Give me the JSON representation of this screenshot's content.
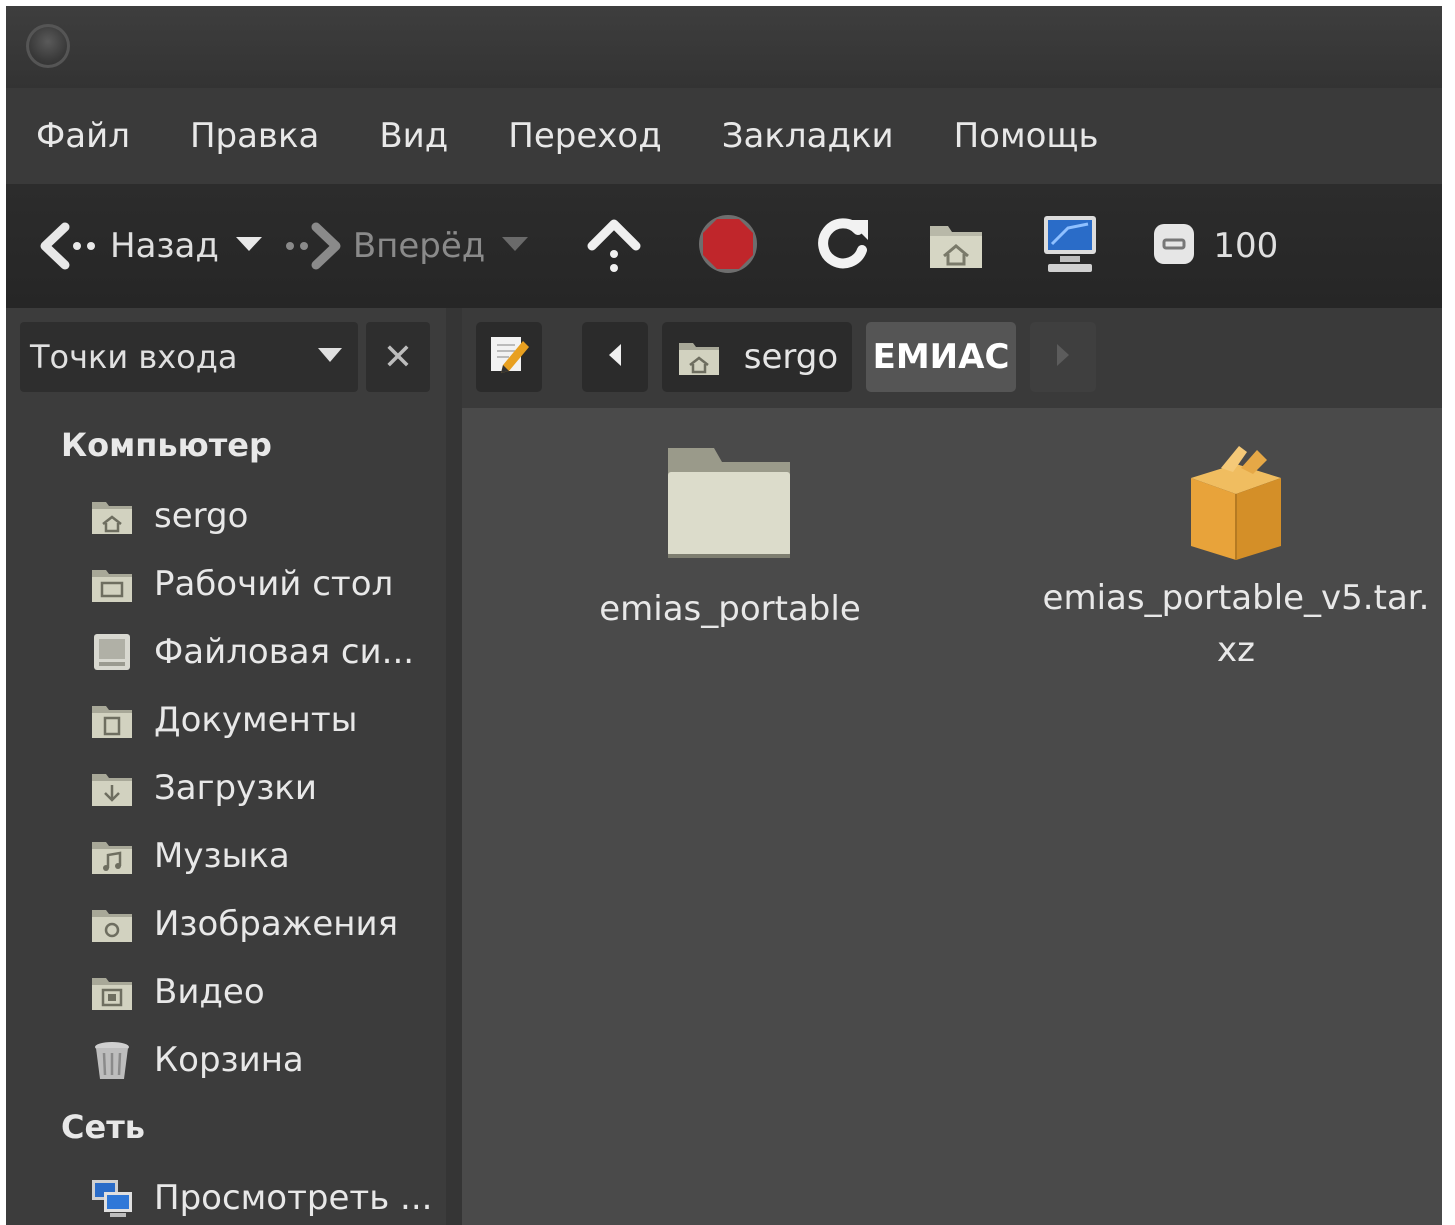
{
  "menu": {
    "items": [
      "Файл",
      "Правка",
      "Вид",
      "Переход",
      "Закладки",
      "Помощь"
    ]
  },
  "toolbar": {
    "back_label": "Назад",
    "forward_label": "Вперёд",
    "zoom_text": "100"
  },
  "sidebar": {
    "selector_label": "Точки входа",
    "computer_header": "Компьютер",
    "places": [
      {
        "label": "sergo",
        "icon": "home-folder-icon"
      },
      {
        "label": "Рабочий стол",
        "icon": "desktop-folder-icon"
      },
      {
        "label": "Файловая си...",
        "icon": "filesystem-icon"
      },
      {
        "label": "Документы",
        "icon": "documents-folder-icon"
      },
      {
        "label": "Загрузки",
        "icon": "downloads-folder-icon"
      },
      {
        "label": "Музыка",
        "icon": "music-folder-icon"
      },
      {
        "label": "Изображения",
        "icon": "pictures-folder-icon"
      },
      {
        "label": "Видео",
        "icon": "videos-folder-icon"
      },
      {
        "label": "Корзина",
        "icon": "trash-icon"
      }
    ],
    "network_header": "Сеть",
    "network_items": [
      {
        "label": "Просмотреть ...",
        "icon": "network-icon"
      }
    ]
  },
  "pathbar": {
    "crumbs": [
      "sergo",
      "ЕМИАС"
    ]
  },
  "files": [
    {
      "name": "emias_portable",
      "icon": "folder-icon"
    },
    {
      "name": "emias_portable_v5.tar.\nxz",
      "icon": "archive-icon"
    }
  ],
  "colors": {
    "window_bg": "#4a4a4a",
    "toolbar_bg": "#2a2a2a",
    "sidebar_bg": "#3c3c3c",
    "stop_red": "#c0262b",
    "archive_orange": "#e8a33a",
    "folder_beige": "#dcdccb"
  }
}
